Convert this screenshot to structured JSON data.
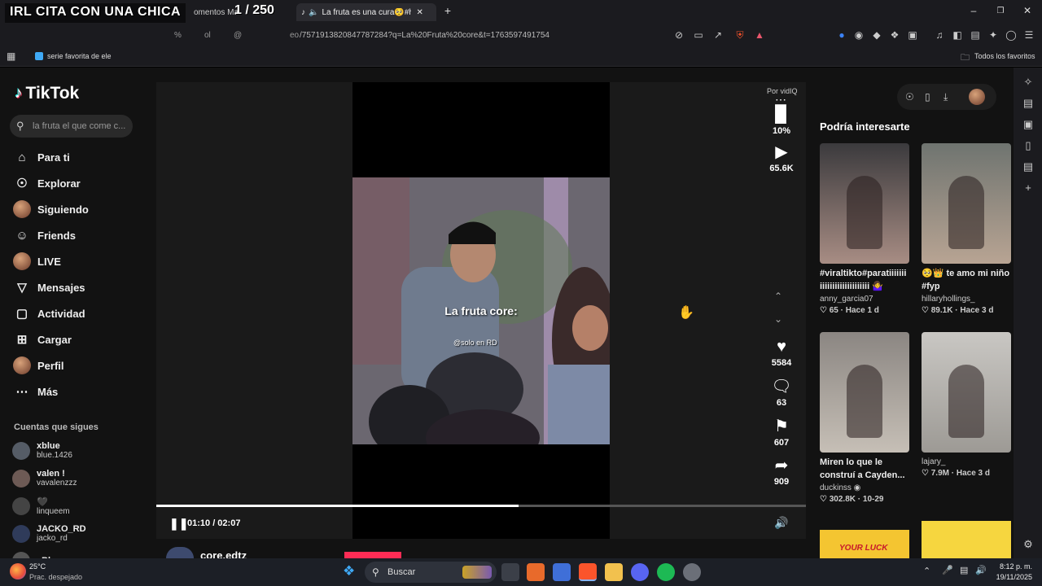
{
  "overlay": {
    "title": "IRL CITA CON UNA CHICA",
    "counter": "1 / 250"
  },
  "browser": {
    "tabs": [
      {
        "label": "omentos Ma"
      },
      {
        "label": "La fruta es una cura🥺#humo"
      }
    ],
    "url": "/7571913820847787284?q=La%20Fruta%20core&t=1763597491754",
    "url_prefix_a": "%",
    "url_prefix_b": "ol",
    "url_prefix_c": "@",
    "url_prefix_d": "eo",
    "bookmark": "serie favorita de ele",
    "all_bookmarks": "Todos los favoritos"
  },
  "tiktok": {
    "logo": "TikTok",
    "search_placeholder": "la fruta el que come c...",
    "nav": [
      {
        "label": "Para ti",
        "icon": "home-icon"
      },
      {
        "label": "Explorar",
        "icon": "compass-icon"
      },
      {
        "label": "Siguiendo",
        "icon": "avatar"
      },
      {
        "label": "Friends",
        "icon": "friends-icon"
      },
      {
        "label": "LIVE",
        "icon": "avatar"
      },
      {
        "label": "Mensajes",
        "icon": "send-icon"
      },
      {
        "label": "Actividad",
        "icon": "activity-icon"
      },
      {
        "label": "Cargar",
        "icon": "plus-square-icon"
      },
      {
        "label": "Perfil",
        "icon": "avatar"
      },
      {
        "label": "Más",
        "icon": "more-icon"
      }
    ],
    "following_heading": "Cuentas que sigues",
    "following": [
      {
        "name": "xblue",
        "handle": "blue.1426"
      },
      {
        "name": "valen !",
        "handle": "vavalenzzz"
      },
      {
        "name": "🖤",
        "handle": "linqueem"
      },
      {
        "name": "JACKO_RD",
        "handle": "jacko_rd"
      },
      {
        "name": "xBlue",
        "handle": ""
      }
    ]
  },
  "video": {
    "caption": "La fruta core:",
    "watermark": "@solo en RD",
    "progress": 0.5573,
    "time": "01:10 / 02:07",
    "creator": "core.edtz",
    "por_vidiq": "Por vidIQ",
    "vidiq_pct": "10%",
    "views": "65.6K",
    "likes": "5584",
    "comments": "63",
    "saves": "607",
    "shares": "909"
  },
  "recommendations": {
    "title": "Podría interesarte",
    "cards": [
      {
        "caption": "#viraltikto#paratiiiiiii iiiiiiiiiiiiiiiiiiii 🤷‍♀️",
        "author": "anny_garcia07",
        "stats": "♡ 65  ·  Hace 1 d",
        "thumb_colors": [
          "#3b3a3d",
          "#a88d84"
        ]
      },
      {
        "caption": "🥺👑 te amo mi niño #fyp",
        "author": "hillaryhollings_",
        "stats": "♡ 89.1K  ·  Hace 3 d",
        "thumb_colors": [
          "#6f7470",
          "#b8a493"
        ]
      },
      {
        "caption": "Miren lo que le construí a Cayden...",
        "author": "duckinss ◉",
        "stats": "♡ 302.8K  ·  10-29",
        "thumb_colors": [
          "#8b8682",
          "#c6bfb6"
        ]
      },
      {
        "caption": "",
        "author": "lajary_",
        "stats": "♡ 7.9M  ·  Hace 3 d",
        "thumb_colors": [
          "#c9c7c3",
          "#9d9a95"
        ]
      }
    ],
    "bottom_card_text": "YOUR LUCK"
  },
  "taskbar": {
    "temp": "25°C",
    "weather": "Prac. despejado",
    "search": "Buscar",
    "time": "8:12 p. m.",
    "date": "19/11/2025"
  }
}
